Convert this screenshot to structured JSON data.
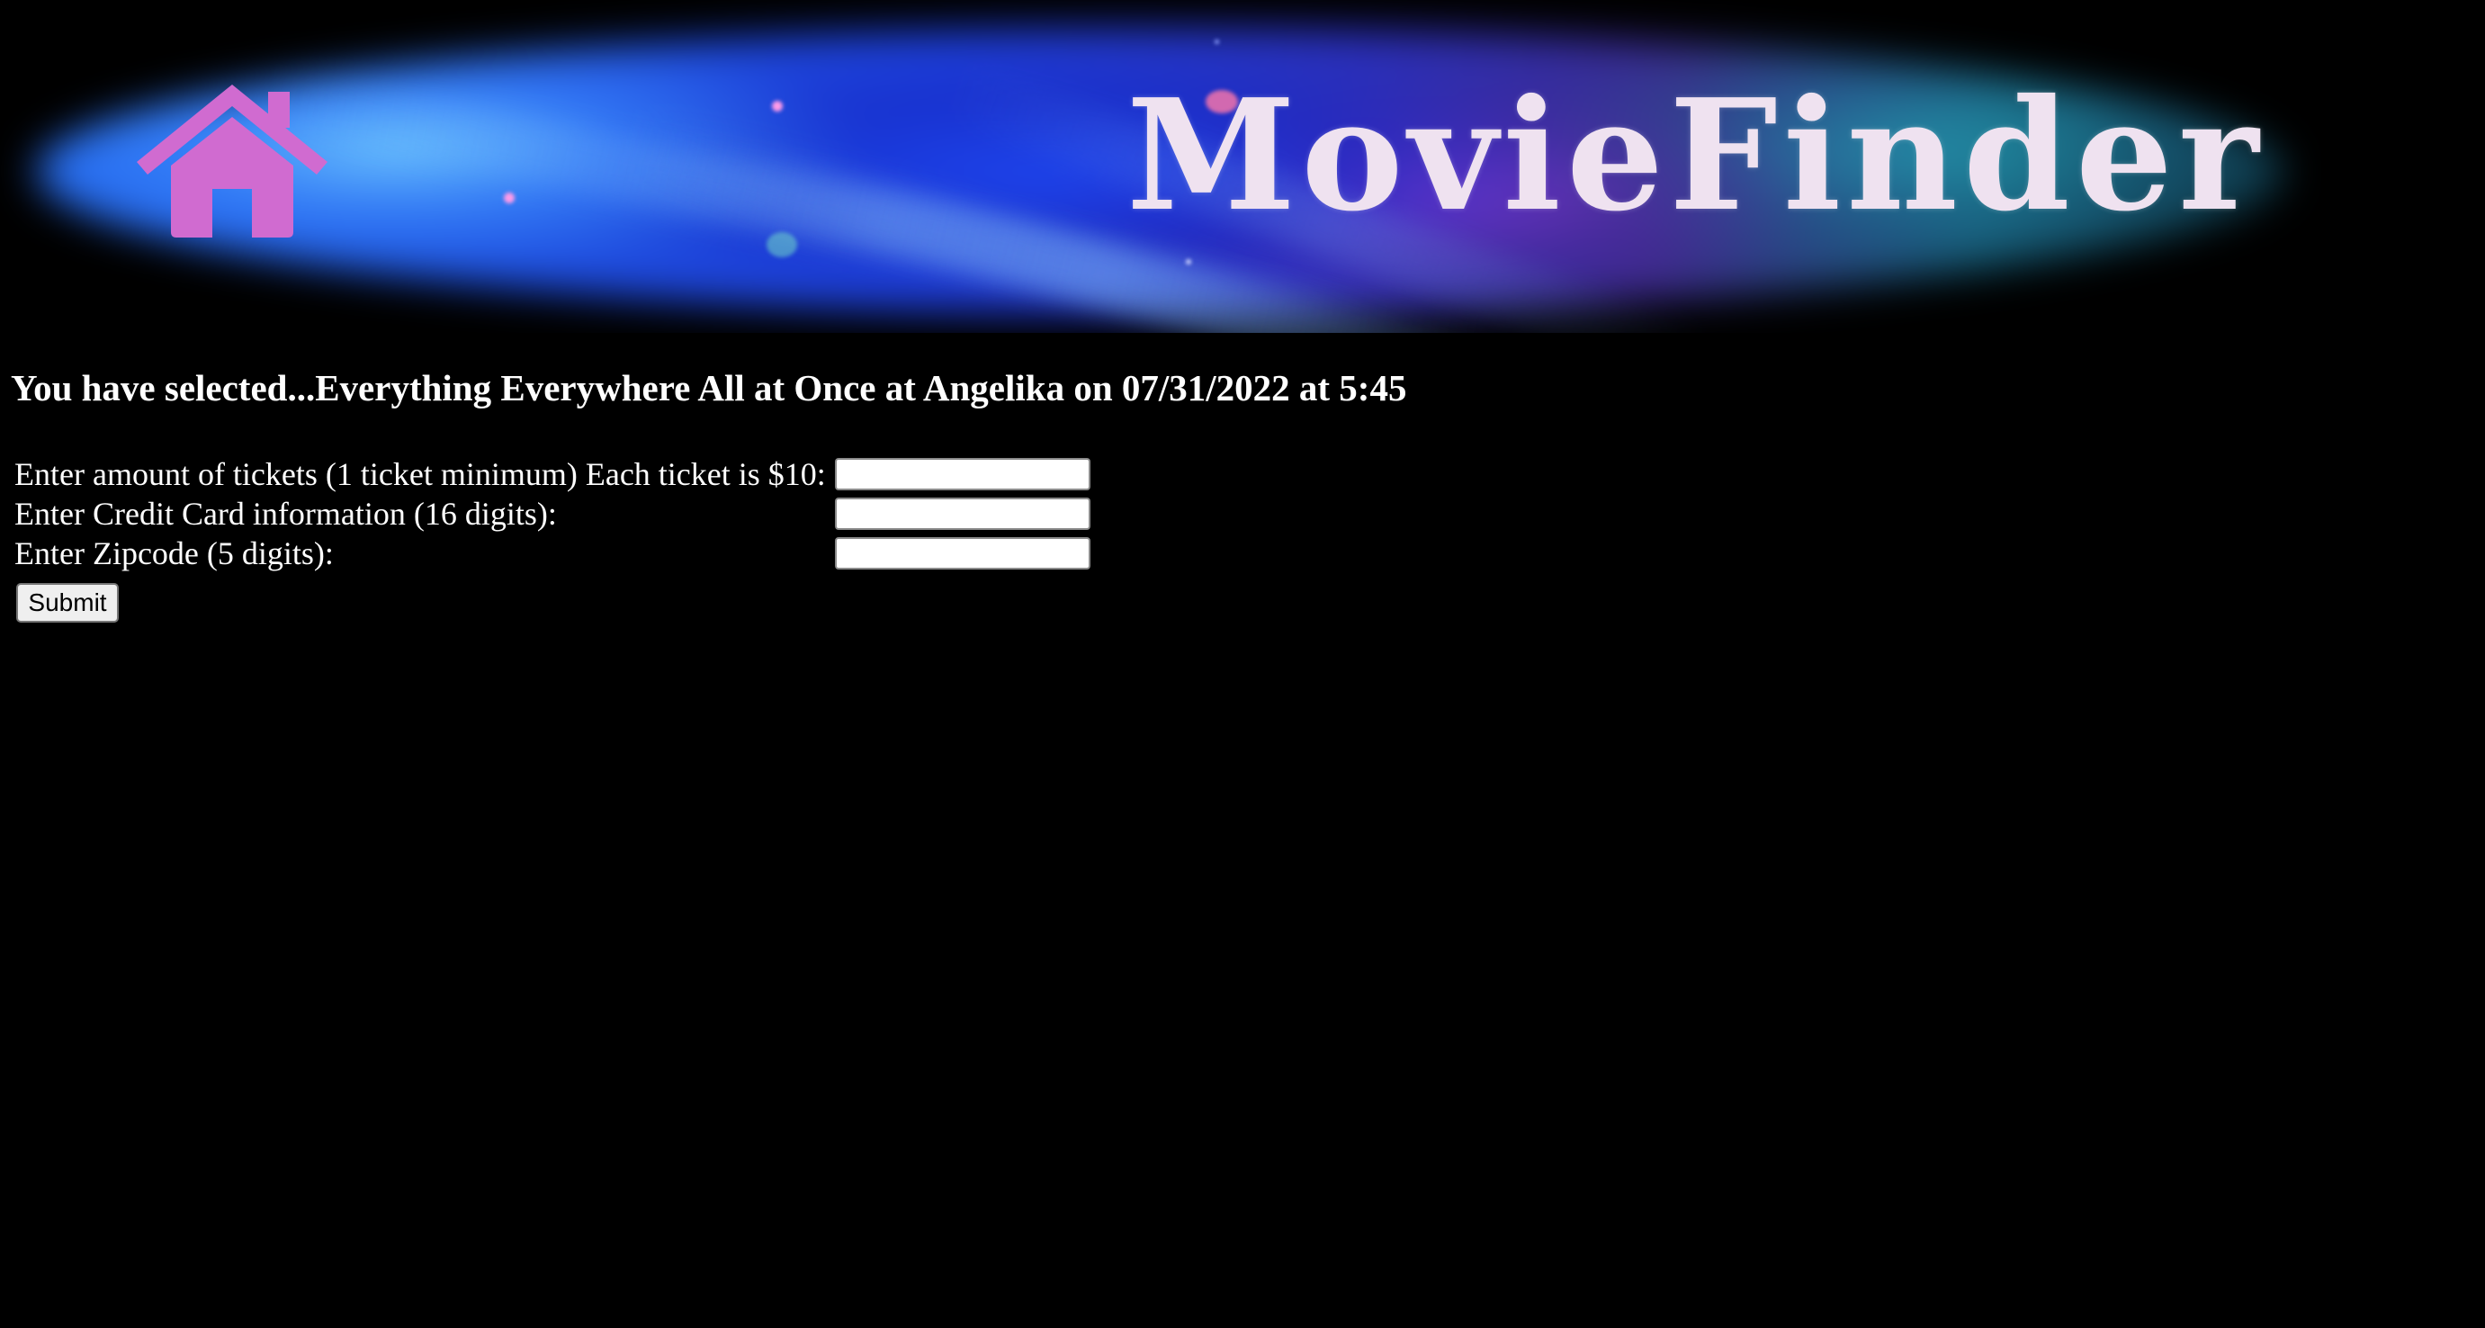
{
  "header": {
    "brand_title": "MovieFinder",
    "home_icon": "home-icon",
    "colors": {
      "home_icon": "#d06bd0",
      "brand_text": "#efe2f0",
      "banner_blue": "#1e3fd8",
      "banner_purple": "#3b2a8a",
      "banner_teal": "#155a73"
    }
  },
  "main": {
    "selection_heading": "You have selected...Everything Everywhere All at Once at Angelika on 07/31/2022 at 5:45",
    "form": {
      "fields": [
        {
          "label": "Enter amount of tickets (1 ticket minimum) Each ticket is $10:",
          "value": "",
          "placeholder": ""
        },
        {
          "label": "Enter Credit Card information (16 digits):",
          "value": "",
          "placeholder": ""
        },
        {
          "label": "Enter Zipcode (5 digits):",
          "value": "",
          "placeholder": ""
        }
      ],
      "submit_label": "Submit"
    }
  },
  "colors": {
    "page_background": "#000000",
    "text": "#ffffff"
  }
}
